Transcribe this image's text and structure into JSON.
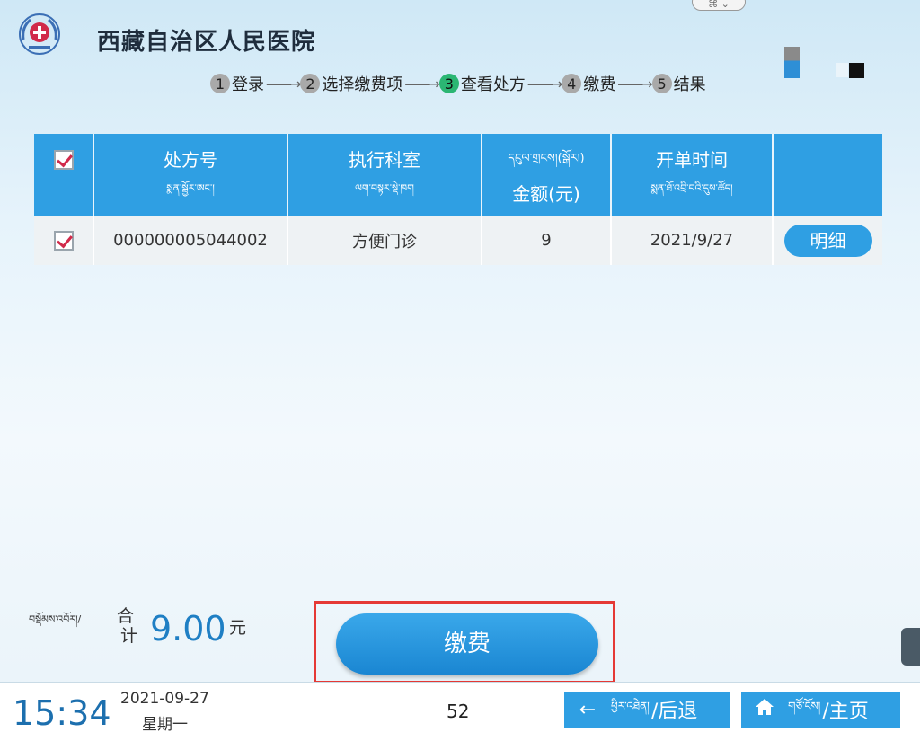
{
  "header": {
    "hospital_name": "西藏自治区人民医院",
    "window_handle": "⌘ ⌄"
  },
  "steps": [
    {
      "num": "1",
      "label": "登录",
      "active": false
    },
    {
      "num": "2",
      "label": "选择缴费项",
      "active": false
    },
    {
      "num": "3",
      "label": "查看处方",
      "active": true
    },
    {
      "num": "4",
      "label": "缴费",
      "active": false
    },
    {
      "num": "5",
      "label": "结果",
      "active": false
    }
  ],
  "table": {
    "headers": {
      "rx_no": "处方号",
      "rx_no_tib": "སྨན་སྦྱོར་ཨང་།",
      "dept": "执行科室",
      "dept_tib": "ལག་བསྟར་སྡེ་ཁག",
      "amount_tib": "དངུལ་གྲངས།(སྒོར།)",
      "amount": "金额(元)",
      "time": "开单时间",
      "time_tib": "སྨན་ཐོ་འབྲི་བའི་དུས་ཚོད།"
    },
    "rows": [
      {
        "rx_no": "000000005044002",
        "dept": "方便门诊",
        "amount": "9",
        "time": "2021/9/27",
        "action": "明细",
        "checked": true
      }
    ]
  },
  "total": {
    "label_tib": "བསྡོམས་འབོར།/",
    "label_cn1": "合",
    "label_cn2": "计",
    "amount": "9.00",
    "unit": "元"
  },
  "pay_button": "缴费",
  "footer": {
    "time": "15:34",
    "date": "2021-09-27",
    "weekday": "星期一",
    "countdown": "52",
    "back_tib": "ཕྱིར་འཐེན།",
    "back": "/后退",
    "home_tib": "གཙོ་ངོས།",
    "home": "/主页"
  },
  "colors": {
    "primary": "#2f9fe3",
    "active_step": "#2bb673",
    "highlight": "#e53935",
    "check": "#d12a4a"
  },
  "icons": {
    "logo": "hospital-emblem-icon",
    "back": "arrow-left-icon",
    "home": "home-icon",
    "checkbox": "checkbox-checked-icon"
  }
}
